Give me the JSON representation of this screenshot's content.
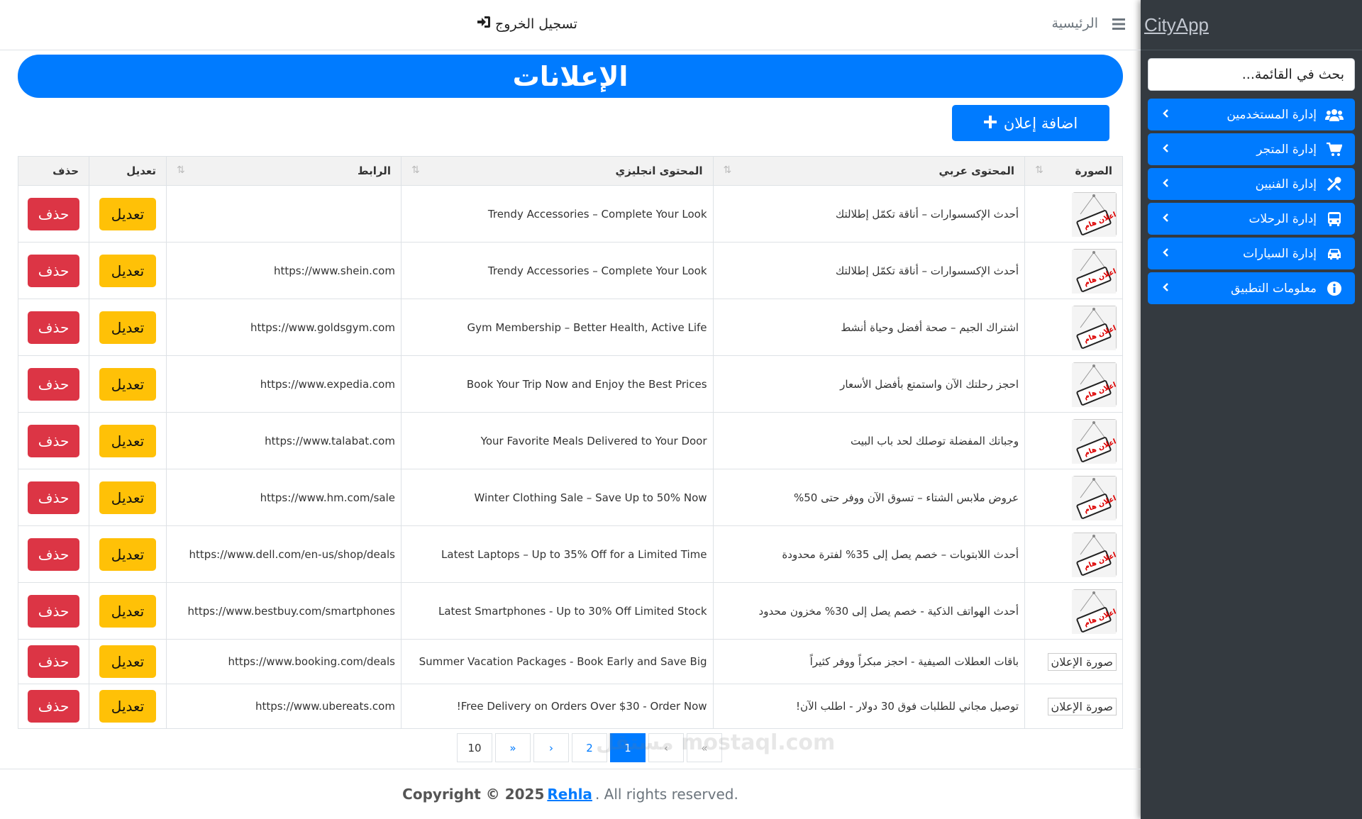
{
  "sidebar": {
    "brand": "CityApp",
    "search_placeholder": "بحث في القائمة...",
    "items": [
      {
        "label": "إدارة المستخدمين",
        "icon": "users-icon"
      },
      {
        "label": "إدارة المتجر",
        "icon": "cart-icon"
      },
      {
        "label": "إدارة الفنيين",
        "icon": "tools-icon"
      },
      {
        "label": "إدارة الرحلات",
        "icon": "bus-icon"
      },
      {
        "label": "إدارة السيارات",
        "icon": "car-icon"
      },
      {
        "label": "معلومات التطبيق",
        "icon": "info-icon"
      }
    ]
  },
  "topbar": {
    "home": "الرئيسية",
    "logout": "تسجيل الخروج"
  },
  "page": {
    "title": "الإعلانات",
    "add_button": "اضافة إعلان"
  },
  "table": {
    "headers": {
      "image": "الصورة",
      "arabic": "المحتوى عربي",
      "english": "المحتوى انجليزي",
      "link": "الرابط",
      "edit": "تعديل",
      "delete": "حذف"
    },
    "edit_label": "تعديل",
    "delete_label": "حذف",
    "image_badge": "اعلان هام",
    "broken_image_alt": "صورة الإعلان",
    "rows": [
      {
        "arabic": "أحدث الإكسسوارات – أناقة تكمّل إطلالتك",
        "english": "Trendy Accessories – Complete Your Look",
        "link": "",
        "image": "badge"
      },
      {
        "arabic": "أحدث الإكسسوارات – أناقة تكمّل إطلالتك",
        "english": "Trendy Accessories – Complete Your Look",
        "link": "https://www.shein.com",
        "image": "badge"
      },
      {
        "arabic": "اشتراك الجيم – صحة أفضل وحياة أنشط",
        "english": "Gym Membership – Better Health, Active Life",
        "link": "https://www.goldsgym.com",
        "image": "badge"
      },
      {
        "arabic": "احجز رحلتك الآن واستمتع بأفضل الأسعار",
        "english": "Book Your Trip Now and Enjoy the Best Prices",
        "link": "https://www.expedia.com",
        "image": "badge"
      },
      {
        "arabic": "وجباتك المفضلة توصلك لحد باب البيت",
        "english": "Your Favorite Meals Delivered to Your Door",
        "link": "https://www.talabat.com",
        "image": "badge"
      },
      {
        "arabic": "عروض ملابس الشتاء – تسوق الآن ووفر حتى 50%",
        "english": "Winter Clothing Sale – Save Up to 50% Now",
        "link": "https://www.hm.com/sale",
        "image": "badge"
      },
      {
        "arabic": "أحدث اللابتوبات – خصم يصل إلى 35% لفترة محدودة",
        "english": "Latest Laptops – Up to 35% Off for a Limited Time",
        "link": "https://www.dell.com/en-us/shop/deals",
        "image": "badge"
      },
      {
        "arabic": "أحدث الهواتف الذكية - خصم يصل إلى 30% مخزون محدود",
        "english": "Latest Smartphones - Up to 30% Off Limited Stock",
        "link": "https://www.bestbuy.com/smartphones",
        "image": "badge"
      },
      {
        "arabic": "باقات العطلات الصيفية - احجز مبكراً ووفر كثيراً",
        "english": "Summer Vacation Packages - Book Early and Save Big",
        "link": "https://www.booking.com/deals",
        "image": "broken"
      },
      {
        "arabic": "توصيل مجاني للطلبات فوق 30 دولار - اطلب الآن!",
        "english": "Free Delivery on Orders Over $30 - Order Now!",
        "link": "https://www.ubereats.com",
        "image": "broken"
      }
    ]
  },
  "pagination": {
    "pages": [
      "«",
      "‹",
      "1",
      "2",
      "›",
      "»",
      "10"
    ],
    "active": "1"
  },
  "footer": {
    "prefix": "Copyright © 2025",
    "brand": "Rehla",
    "suffix": ". All rights reserved."
  },
  "watermark": "مستقل mostaql.com"
}
